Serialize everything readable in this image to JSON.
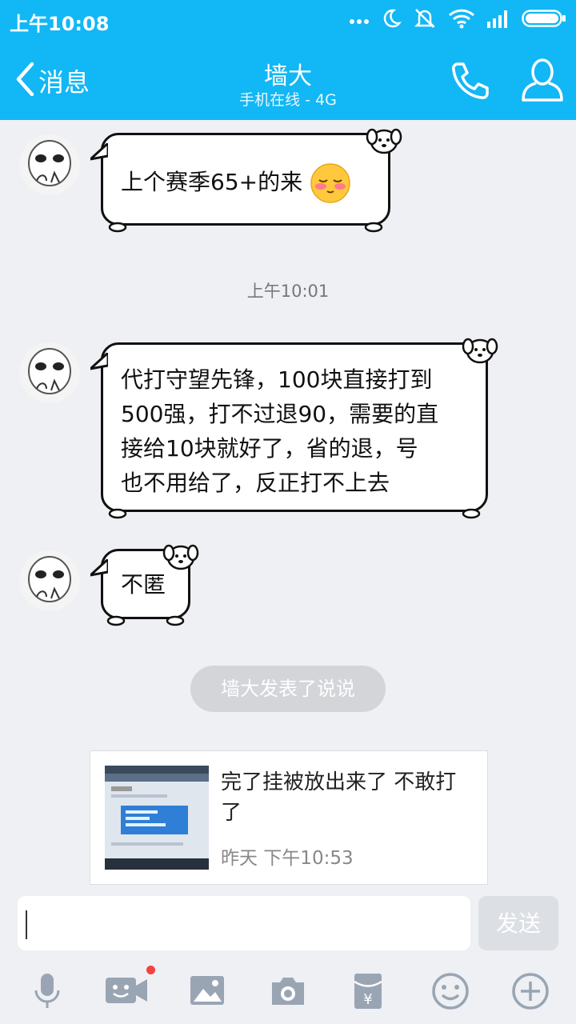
{
  "status_bar": {
    "time": "上午10:08",
    "icons": [
      "more-dots-icon",
      "moon-icon",
      "mute-icon",
      "wifi-icon",
      "signal-icon",
      "battery-icon"
    ]
  },
  "header": {
    "back_label": "消息",
    "title": "墙大",
    "subtitle": "手机在线 - 4G",
    "icons": [
      "back-chevron-icon",
      "phone-icon",
      "profile-icon"
    ]
  },
  "messages": [
    {
      "sender": "墙大",
      "lines": [
        "上个赛季65+的来"
      ],
      "emoji": "blush-emoji-icon"
    },
    {
      "sender": "墙大",
      "lines": [
        "代打守望先锋，100块直接打到",
        "500强，打不过退90，需要的直",
        "接给10块就好了，省的退，号",
        "也不用给了，反正打不上去"
      ]
    },
    {
      "sender": "墙大",
      "lines": [
        "不匿"
      ]
    }
  ],
  "timestamp": "上午10:01",
  "system_note": "墙大发表了说说",
  "shared_post": {
    "text": "完了挂被放出来了 不敢打了",
    "time": "昨天 下午10:53"
  },
  "input": {
    "value": "",
    "send_label": "发送"
  },
  "toolbar": {
    "icons": [
      "microphone-icon",
      "video-icon",
      "image-icon",
      "camera-icon",
      "red-packet-icon",
      "emoji-icon",
      "plus-icon"
    ],
    "badge_color": "#f5423c"
  },
  "colors": {
    "accent": "#12b7f5",
    "background": "#eef0f4"
  }
}
